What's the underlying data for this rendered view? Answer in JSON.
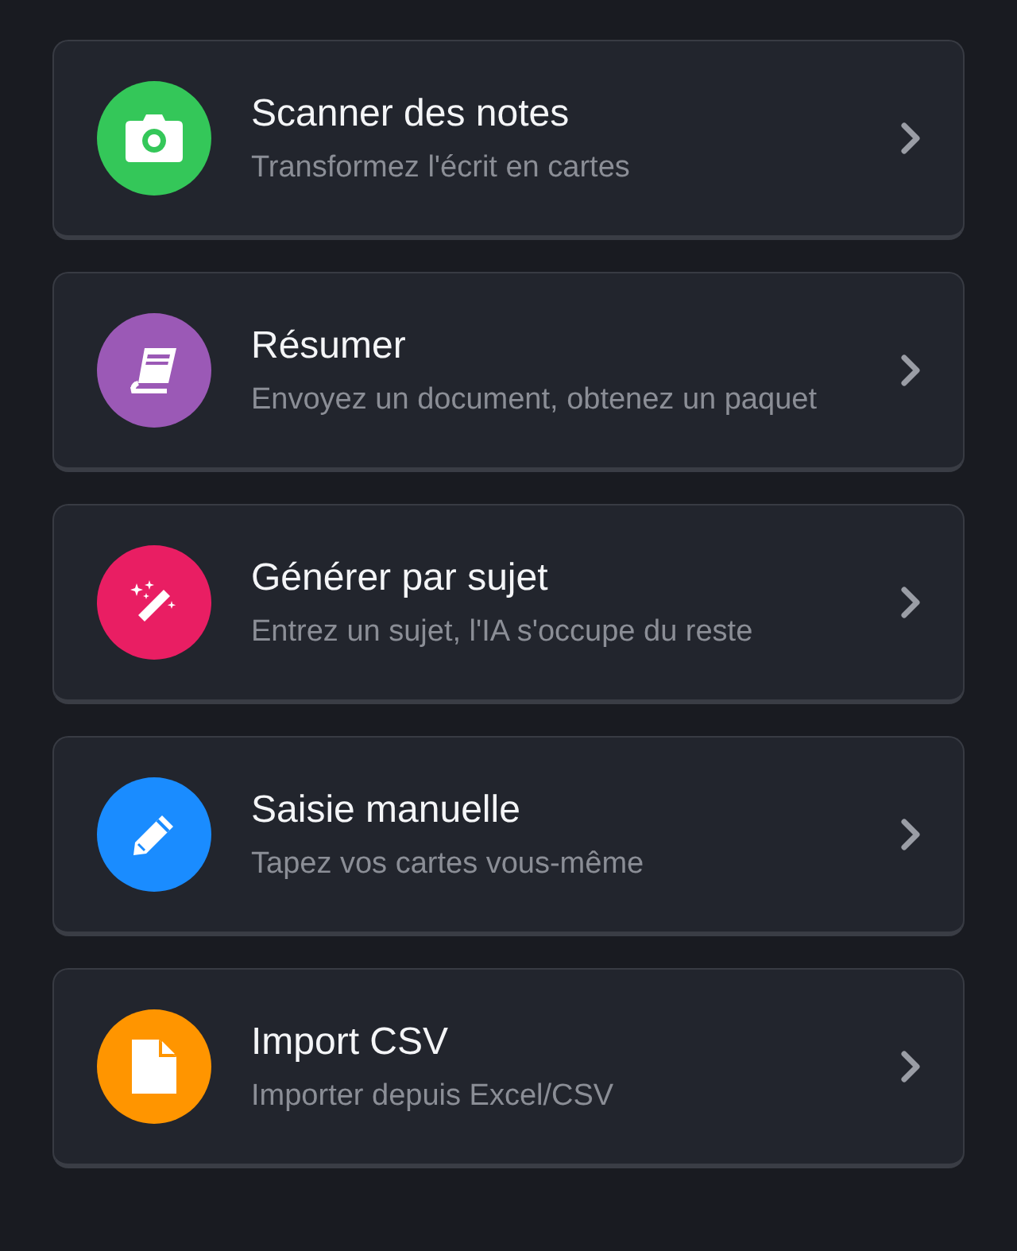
{
  "options": [
    {
      "title": "Scanner des notes",
      "subtitle": "Transformez l'écrit en cartes",
      "color": "#34c759"
    },
    {
      "title": "Résumer",
      "subtitle": "Envoyez un document, obtenez un paquet",
      "color": "#9b59b6"
    },
    {
      "title": "Générer par sujet",
      "subtitle": "Entrez un sujet, l'IA s'occupe du reste",
      "color": "#e91e63"
    },
    {
      "title": "Saisie manuelle",
      "subtitle": "Tapez vos cartes vous-même",
      "color": "#1a8cff"
    },
    {
      "title": "Import CSV",
      "subtitle": "Importer depuis Excel/CSV",
      "color": "#ff9500"
    }
  ]
}
